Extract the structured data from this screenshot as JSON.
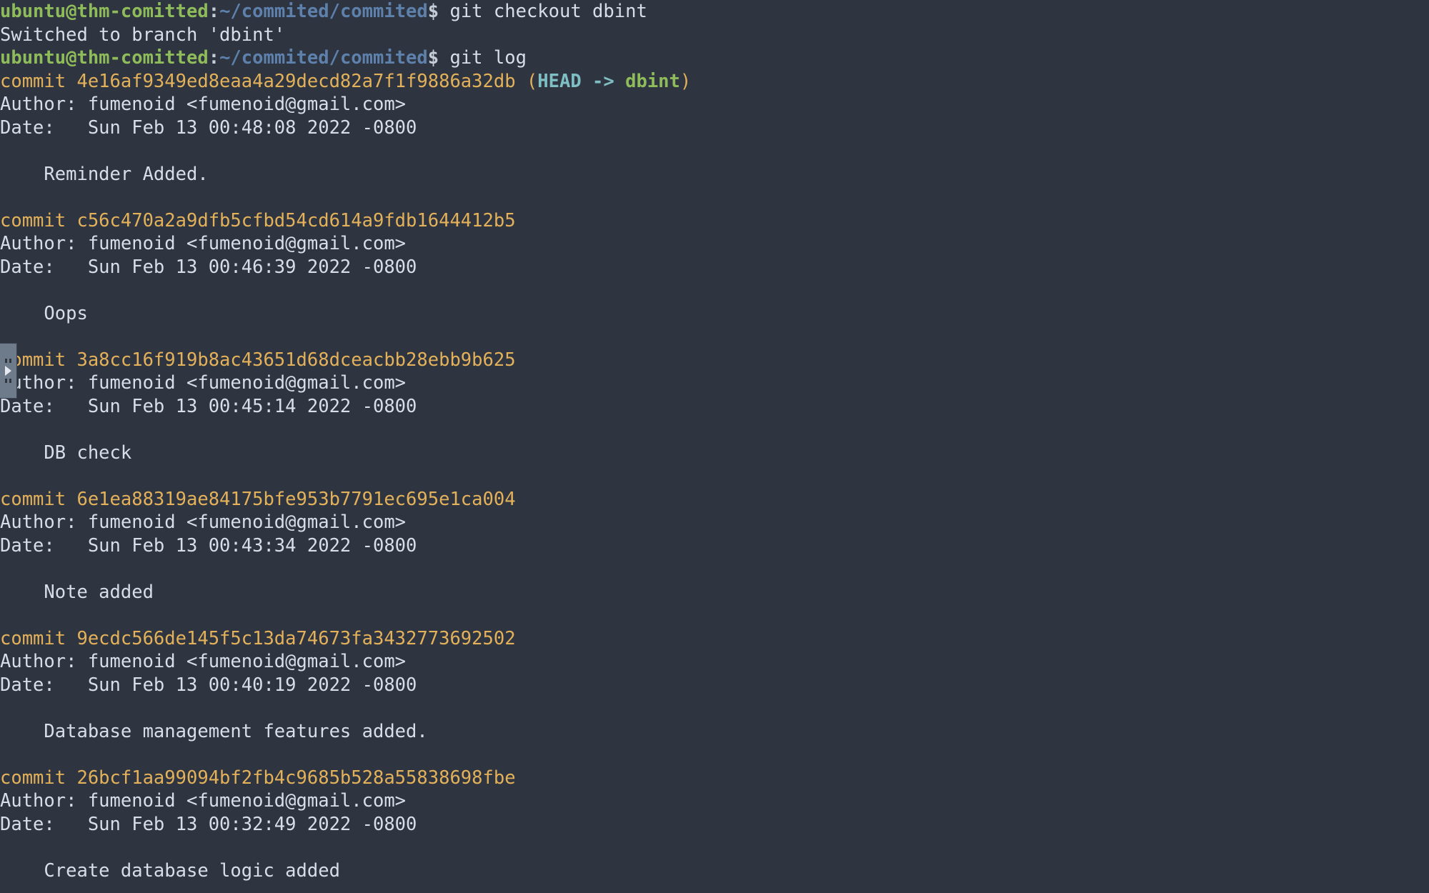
{
  "prompt": {
    "user": "ubuntu@thm-comitted",
    "colon": ":",
    "path": "~/commited/commited",
    "dollar": "$"
  },
  "lines": [
    {
      "type": "prompt-cmd",
      "cmd": " git checkout dbint"
    },
    {
      "type": "plain",
      "text": "Switched to branch 'dbint'"
    },
    {
      "type": "prompt-cmd",
      "cmd": " git log"
    },
    {
      "type": "commit-head",
      "word": "commit ",
      "hash": "4e16af9349ed8eaa4a29decd82a7f1f9886a32db",
      "open": " (",
      "head": "HEAD -> ",
      "branch": "dbint",
      "close": ")"
    },
    {
      "type": "plain",
      "text": "Author: fumenoid <fumenoid@gmail.com>"
    },
    {
      "type": "plain",
      "text": "Date:   Sun Feb 13 00:48:08 2022 -0800"
    },
    {
      "type": "blank"
    },
    {
      "type": "msg",
      "text": "    Reminder Added."
    },
    {
      "type": "blank"
    },
    {
      "type": "commit",
      "word": "commit ",
      "hash": "c56c470a2a9dfb5cfbd54cd614a9fdb1644412b5"
    },
    {
      "type": "plain",
      "text": "Author: fumenoid <fumenoid@gmail.com>"
    },
    {
      "type": "plain",
      "text": "Date:   Sun Feb 13 00:46:39 2022 -0800"
    },
    {
      "type": "blank"
    },
    {
      "type": "msg",
      "text": "    Oops"
    },
    {
      "type": "blank"
    },
    {
      "type": "commit",
      "word": "commit ",
      "hash": "3a8cc16f919b8ac43651d68dceacbb28ebb9b625"
    },
    {
      "type": "plain",
      "text": "Author: fumenoid <fumenoid@gmail.com>"
    },
    {
      "type": "plain",
      "text": "Date:   Sun Feb 13 00:45:14 2022 -0800"
    },
    {
      "type": "blank"
    },
    {
      "type": "msg",
      "text": "    DB check"
    },
    {
      "type": "blank"
    },
    {
      "type": "commit",
      "word": "commit ",
      "hash": "6e1ea88319ae84175bfe953b7791ec695e1ca004"
    },
    {
      "type": "plain",
      "text": "Author: fumenoid <fumenoid@gmail.com>"
    },
    {
      "type": "plain",
      "text": "Date:   Sun Feb 13 00:43:34 2022 -0800"
    },
    {
      "type": "blank"
    },
    {
      "type": "msg",
      "text": "    Note added"
    },
    {
      "type": "blank"
    },
    {
      "type": "commit",
      "word": "commit ",
      "hash": "9ecdc566de145f5c13da74673fa3432773692502"
    },
    {
      "type": "plain",
      "text": "Author: fumenoid <fumenoid@gmail.com>"
    },
    {
      "type": "plain",
      "text": "Date:   Sun Feb 13 00:40:19 2022 -0800"
    },
    {
      "type": "blank"
    },
    {
      "type": "msg",
      "text": "    Database management features added."
    },
    {
      "type": "blank"
    },
    {
      "type": "commit",
      "word": "commit ",
      "hash": "26bcf1aa99094bf2fb4c9685b528a55838698fbe"
    },
    {
      "type": "plain",
      "text": "Author: fumenoid <fumenoid@gmail.com>"
    },
    {
      "type": "plain",
      "text": "Date:   Sun Feb 13 00:32:49 2022 -0800"
    },
    {
      "type": "blank"
    },
    {
      "type": "msg",
      "text": "    Create database logic added"
    }
  ]
}
